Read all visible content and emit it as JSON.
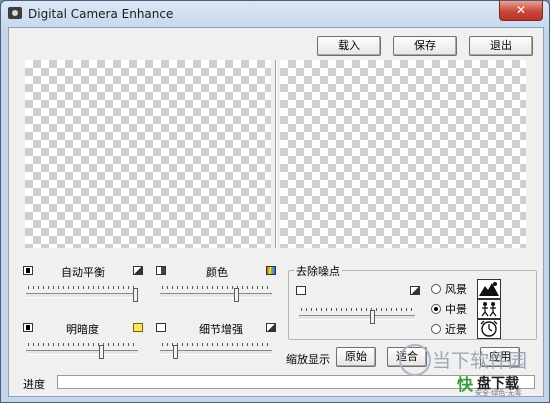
{
  "window": {
    "title": "Digital Camera Enhance",
    "close_glyph": "✕"
  },
  "toolbar": {
    "load_label": "载入",
    "save_label": "保存",
    "exit_label": "退出"
  },
  "adjust": {
    "white_balance": {
      "label": "自动平衡",
      "value": 0.98
    },
    "color": {
      "label": "颜色",
      "value": 0.69
    },
    "brightness": {
      "label": "明暗度",
      "value": 0.68
    },
    "detail": {
      "label": "细节增强",
      "value": 0.14
    }
  },
  "noise": {
    "legend": "去除噪点",
    "value": 0.64,
    "options": [
      {
        "label": "风景",
        "selected": false,
        "icon": "mountain-icon"
      },
      {
        "label": "中景",
        "selected": true,
        "icon": "people-icon"
      },
      {
        "label": "近景",
        "selected": false,
        "icon": "clock-icon"
      }
    ]
  },
  "zoom": {
    "label": "缩放显示",
    "original_label": "原始",
    "fit_label": "适合",
    "apply_label": "应用"
  },
  "progress": {
    "label": "进度",
    "value": 0
  },
  "watermark": {
    "text1": "当下软件园",
    "text2": "快",
    "text3": "盘下载",
    "text4": "安全·绿色·无毒"
  }
}
